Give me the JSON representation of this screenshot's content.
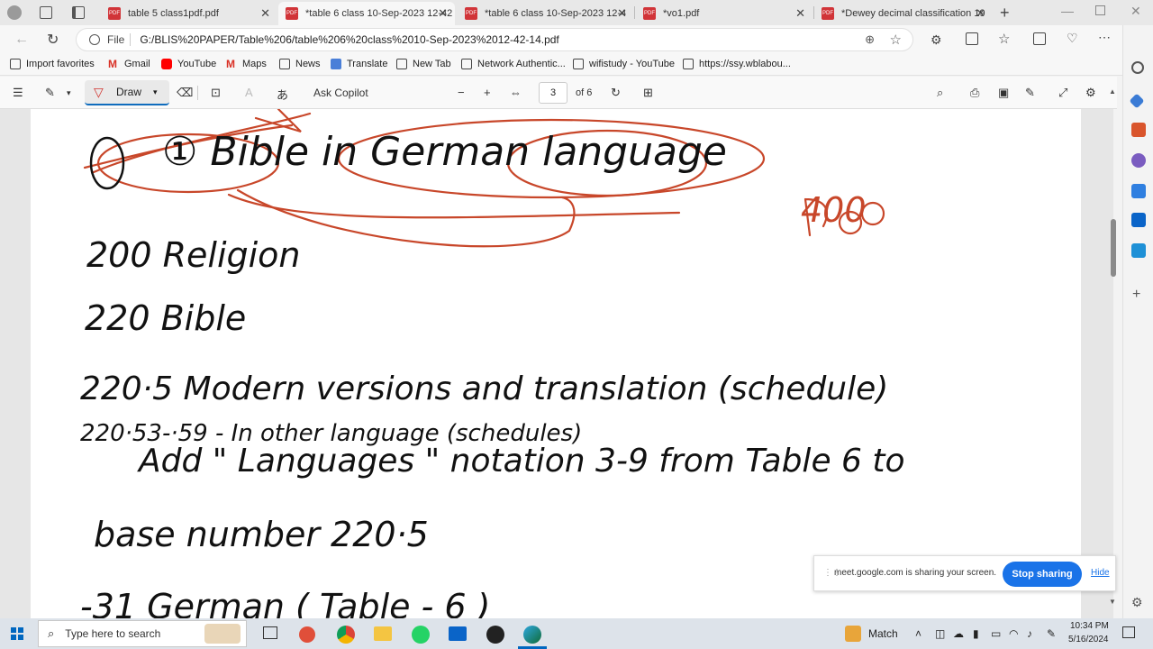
{
  "tabs": [
    {
      "label": "table 5 class1pdf.pdf"
    },
    {
      "label": "*table 6 class 10-Sep-2023 12-42"
    },
    {
      "label": "*table 6 class 10-Sep-2023 12-4"
    },
    {
      "label": "*vo1.pdf"
    },
    {
      "label": "*Dewey decimal classification 19"
    }
  ],
  "address": {
    "prefix": "File",
    "url": "G:/BLIS%20PAPER/Table%206/table%206%20class%2010-Sep-2023%2012-42-14.pdf"
  },
  "favorites": [
    {
      "label": "Import favorites"
    },
    {
      "label": "Gmail"
    },
    {
      "label": "YouTube"
    },
    {
      "label": "Maps"
    },
    {
      "label": "News"
    },
    {
      "label": "Translate"
    },
    {
      "label": "New Tab"
    },
    {
      "label": "Network Authentic..."
    },
    {
      "label": "wifistudy - YouTube"
    },
    {
      "label": "https://ssy.wblabou..."
    }
  ],
  "pdf_toolbar": {
    "draw_label": "Draw",
    "copilot_label": "Ask Copilot",
    "page_current": "3",
    "page_total": "of 6"
  },
  "document": {
    "lines": [
      {
        "text": "① Bible in German language"
      },
      {
        "text": "200  Religion"
      },
      {
        "text": "220  Bible"
      },
      {
        "text": "220·5  Modern versions and translation (schedule)"
      },
      {
        "text": "220·53-·59 - In other language (schedules)"
      },
      {
        "text": "Add \" Languages \" notation 3-9 from Table 6 to"
      },
      {
        "text": "base number 220·5"
      },
      {
        "text": "-31 German  ( Table - 6 )"
      }
    ],
    "margin_note": "400"
  },
  "share_banner": {
    "text": "meet.google.com is sharing your screen.",
    "stop_label": "Stop sharing",
    "hide_label": "Hide"
  },
  "taskbar": {
    "search_placeholder": "Type here to search",
    "weather_label": "Match",
    "time": "10:34 PM",
    "date": "5/16/2024"
  }
}
